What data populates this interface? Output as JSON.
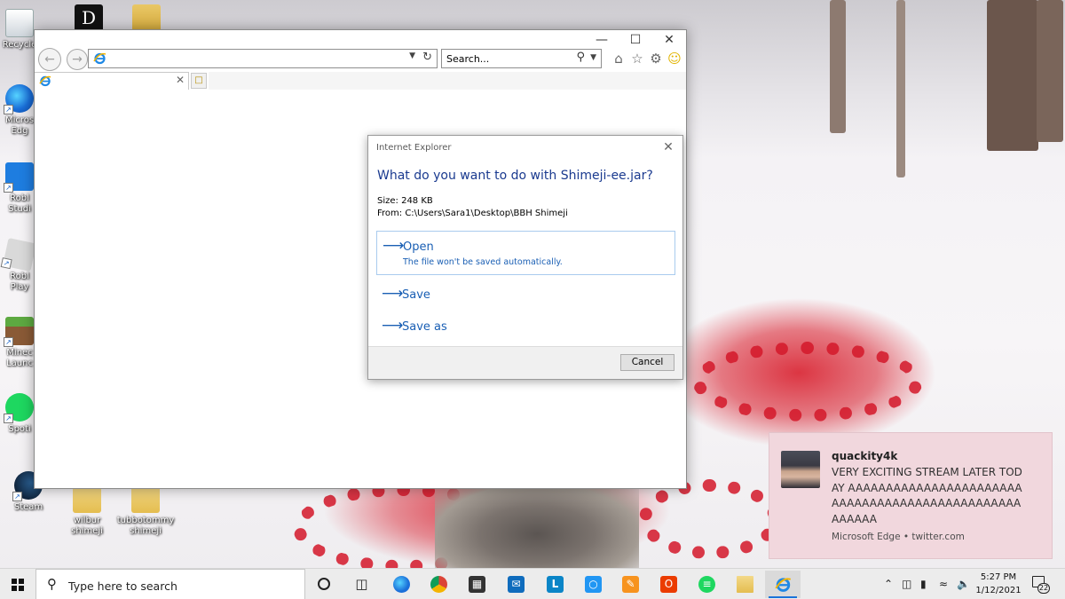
{
  "desktop": {
    "icons": [
      {
        "label_line1": "Recycle",
        "label_line2": ""
      },
      {
        "label_line1": "Micros",
        "label_line2": "Edg"
      },
      {
        "label_line1": "Robl",
        "label_line2": "Studi"
      },
      {
        "label_line1": "Robl",
        "label_line2": "Play"
      },
      {
        "label_line1": "Minec",
        "label_line2": "Launc"
      },
      {
        "label_line1": "Spoti",
        "label_line2": ""
      },
      {
        "label_line1": "Steam",
        "label_line2": ""
      },
      {
        "label_line1": "wilbur",
        "label_line2": "shimeji"
      },
      {
        "label_line1": "tubbotommy",
        "label_line2": "shimeji"
      }
    ]
  },
  "browser": {
    "address_value": "",
    "search_placeholder": "Search...",
    "tab_title": "",
    "toolbar_icons": [
      "home-icon",
      "favorites-star-icon",
      "settings-gear-icon",
      "feedback-smiley-icon"
    ]
  },
  "dialog": {
    "window_title": "Internet Explorer",
    "heading": "What do you want to do with Shimeji-ee.jar?",
    "size_line": "Size: 248 KB",
    "from_line": "From: C:\\Users\\Sara1\\Desktop\\BBH Shimeji",
    "options": [
      {
        "label": "Open",
        "sub": "The file won't be saved automatically."
      },
      {
        "label": "Save",
        "sub": ""
      },
      {
        "label": "Save as",
        "sub": ""
      }
    ],
    "cancel_label": "Cancel"
  },
  "notification": {
    "sender": "quackity4k",
    "message": "VERY EXCITING STREAM LATER TODAY AAAAAAAAAAAAAAAAAAAAAAAAAAAAAAAAAAAAAAAAAAAAAAAAAAAAAA",
    "source": "Microsoft Edge • twitter.com"
  },
  "taskbar": {
    "search_placeholder": "Type here to search",
    "time": "5:27 PM",
    "date": "1/12/2021",
    "notification_count": "22",
    "pinned_apps": [
      "cortana-icon",
      "task-view-icon",
      "edge-icon",
      "chrome-icon",
      "store-icon",
      "mail-icon",
      "l-app-icon",
      "app-icon",
      "studio-icon",
      "office-icon",
      "spotify-icon",
      "file-explorer-icon",
      "internet-explorer-icon"
    ]
  },
  "colors": {
    "accent_blue": "#1a5fb4",
    "dialog_heading": "#1a3a8f",
    "toast_bg": "#f1d7dd",
    "taskbar_bg": "#ececec"
  }
}
